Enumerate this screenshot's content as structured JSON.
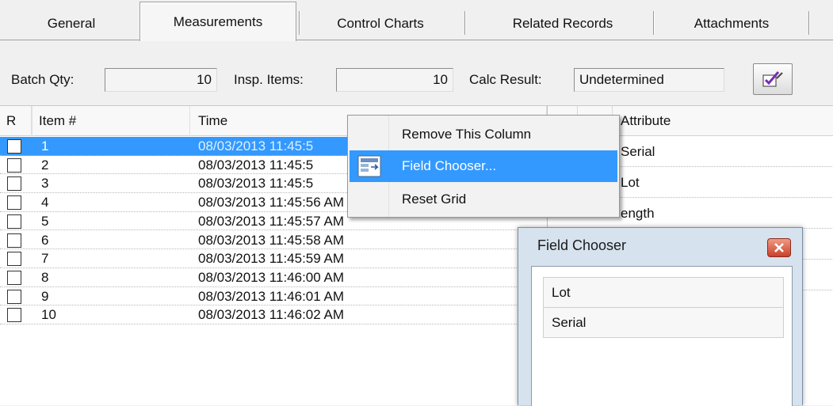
{
  "tabs": [
    {
      "label": "General",
      "active": false
    },
    {
      "label": "Measurements",
      "active": true
    },
    {
      "label": "Control Charts",
      "active": false
    },
    {
      "label": "Related Records",
      "active": false
    },
    {
      "label": "Attachments",
      "active": false
    }
  ],
  "toolbar": {
    "batch_qty_label": "Batch Qty:",
    "batch_qty_value": "10",
    "insp_items_label": "Insp. Items:",
    "insp_items_value": "10",
    "calc_result_label": "Calc Result:",
    "calc_result_value": "Undetermined",
    "action_icon": "edit-check-icon"
  },
  "grid": {
    "columns": [
      "R",
      "Item #",
      "Time"
    ],
    "rows": [
      {
        "item": "1",
        "time": "08/03/2013 11:45:5",
        "selected": true
      },
      {
        "item": "2",
        "time": "08/03/2013 11:45:5",
        "selected": false
      },
      {
        "item": "3",
        "time": "08/03/2013 11:45:5",
        "selected": false
      },
      {
        "item": "4",
        "time": "08/03/2013 11:45:56 AM",
        "selected": false
      },
      {
        "item": "5",
        "time": "08/03/2013 11:45:57 AM",
        "selected": false
      },
      {
        "item": "6",
        "time": "08/03/2013 11:45:58 AM",
        "selected": false
      },
      {
        "item": "7",
        "time": "08/03/2013 11:45:59 AM",
        "selected": false
      },
      {
        "item": "8",
        "time": "08/03/2013 11:46:00 AM",
        "selected": false
      },
      {
        "item": "9",
        "time": "08/03/2013 11:46:01 AM",
        "selected": false
      },
      {
        "item": "10",
        "time": "08/03/2013 11:46:02 AM",
        "selected": false
      }
    ]
  },
  "attributes_grid": {
    "header": "Attribute",
    "rows": [
      "Serial",
      "Lot",
      "ength"
    ]
  },
  "context_menu": {
    "items": [
      {
        "label": "Remove This Column",
        "highlighted": false
      },
      {
        "label": "Field Chooser...",
        "highlighted": true,
        "icon": "field-chooser-icon"
      },
      {
        "label": "Reset Grid",
        "highlighted": false
      }
    ]
  },
  "field_chooser": {
    "title": "Field Chooser",
    "items": [
      "Lot",
      "Serial"
    ]
  }
}
